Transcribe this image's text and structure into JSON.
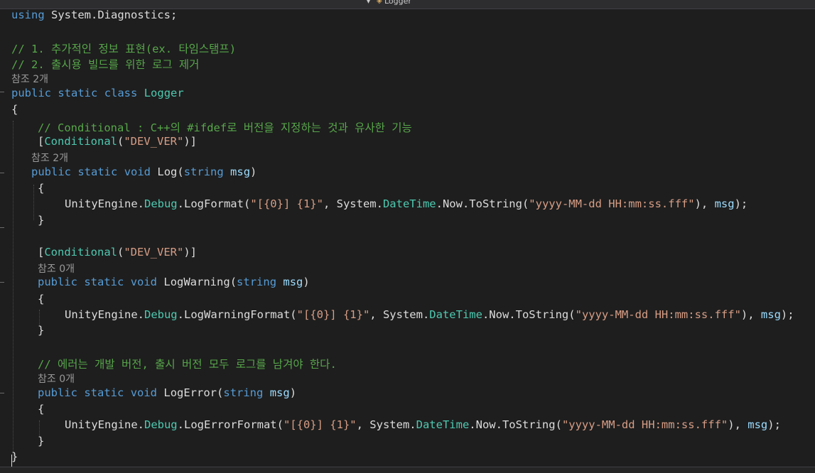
{
  "window": {
    "class_dropdown_label": "Logger"
  },
  "code": {
    "l_using": {
      "kw": "using",
      "rest": " System.Diagnostics;"
    },
    "l_comment1": "// 1. 추가적인 정보 표현(ex. 타임스탬프)",
    "l_comment2": "// 2. 출시용 빌드를 위한 로그 제거",
    "lens_class": "참조 2개",
    "l_class": {
      "kw1": "public",
      "kw2": "static",
      "kw3": "class",
      "name": "Logger"
    },
    "brace_open": "{",
    "brace_close": "}",
    "l_comment3": "// Conditional : C++의 #ifdef로 버전을 지정하는 것과 유사한 기능",
    "attr": {
      "open": "[",
      "name": "Conditional",
      "paren_open": "(",
      "arg": "\"DEV_VER\"",
      "close": ")]"
    },
    "lens_log": "참조 2개",
    "m_log": {
      "kw1": "public",
      "kw2": "static",
      "kw3": "void",
      "name": "Log",
      "open": "(",
      "ptype": "string",
      "pname": "msg",
      "close": ")"
    },
    "call_log": {
      "ns": "UnityEngine.",
      "cls": "Debug",
      "method": ".LogFormat(",
      "fmt": "\"[{0}] {1}\"",
      "sep1": ", System.",
      "dt": "DateTime",
      "now": ".Now.ToString(",
      "dfmt": "\"yyyy-MM-dd HH:mm:ss.fff\"",
      "sep2": "), ",
      "arg": "msg",
      "end": ");"
    },
    "lens_warn": "참조 0개",
    "m_warn": {
      "kw1": "public",
      "kw2": "static",
      "kw3": "void",
      "name": "LogWarning",
      "open": "(",
      "ptype": "string",
      "pname": "msg",
      "close": ")"
    },
    "call_warn": {
      "ns": "UnityEngine.",
      "cls": "Debug",
      "method": ".LogWarningFormat(",
      "fmt": "\"[{0}] {1}\"",
      "sep1": ", System.",
      "dt": "DateTime",
      "now": ".Now.ToString(",
      "dfmt": "\"yyyy-MM-dd HH:mm:ss.fff\"",
      "sep2": "), ",
      "arg": "msg",
      "end": ");"
    },
    "l_comment4": "// 에러는 개발 버전, 출시 버전 모두 로그를 남겨야 한다.",
    "lens_err": "참조 0개",
    "m_err": {
      "kw1": "public",
      "kw2": "static",
      "kw3": "void",
      "name": "LogError",
      "open": "(",
      "ptype": "string",
      "pname": "msg",
      "close": ")"
    },
    "call_err": {
      "ns": "UnityEngine.",
      "cls": "Debug",
      "method": ".LogErrorFormat(",
      "fmt": "\"[{0}] {1}\"",
      "sep1": ", System.",
      "dt": "DateTime",
      "now": ".Now.ToString(",
      "dfmt": "\"yyyy-MM-dd HH:mm:ss.fff\"",
      "sep2": "), ",
      "arg": "msg",
      "end": ");"
    }
  },
  "colors": {
    "keyword": "#569cd6",
    "type": "#4ec9b0",
    "string": "#d69d85",
    "comment": "#57a64a",
    "param": "#9cdcfe",
    "text": "#dcdcdc",
    "background": "#1e1e1e"
  }
}
